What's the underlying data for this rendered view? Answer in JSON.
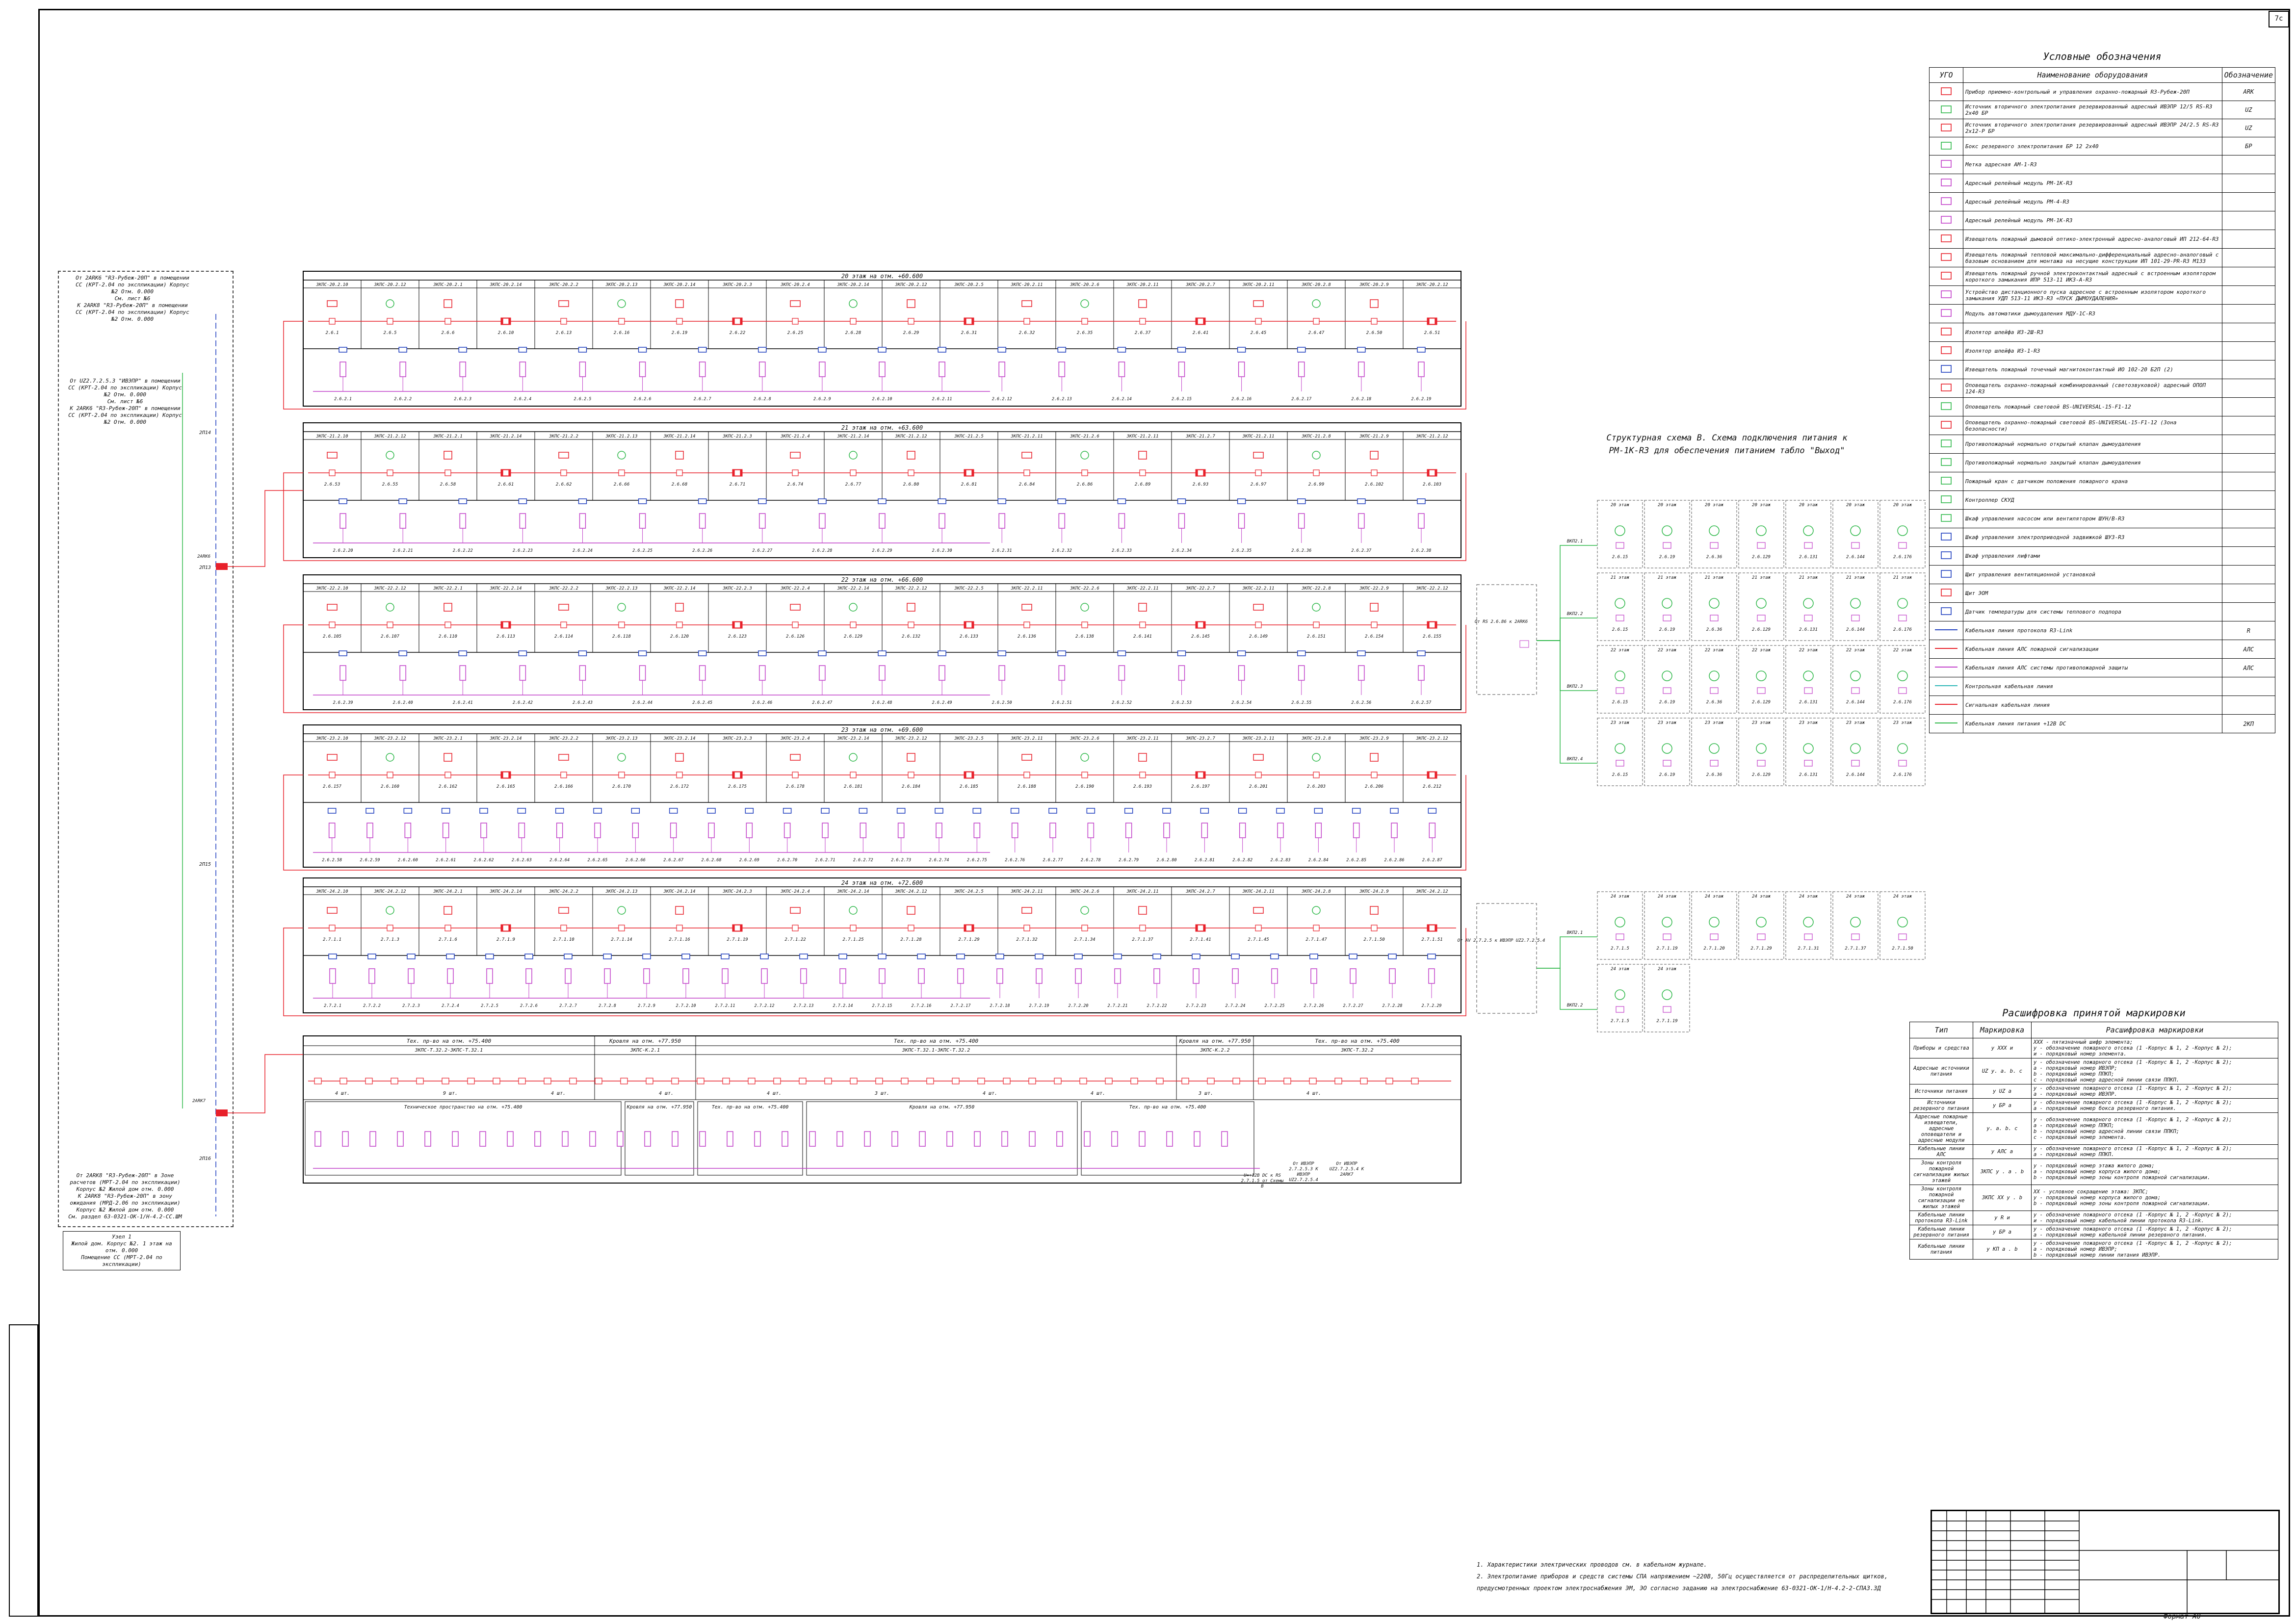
{
  "sheet": {
    "tag": "7с",
    "format": "Формат А0"
  },
  "left_notes": {
    "top": "От 2АRК6 \"R3-Рубеж-20П\" в помещении СС (КРТ-2.04 по экспликации) Корпус №2 Отм. 0.000\nСм. лист №6\nК 2АRК8 \"R3-Рубеж-20П\" в помещении СС (КРТ-2.04 по экспликации) Корпус №2 Отм. 0.000",
    "middle": "От UZ2.7.2.5.3 \"ИВЭПР\" в помещении СС (КРТ-2.04 по экспликации) Корпус №2 Отм. 0.000\nСм. лист №6\nК 2АRК6 \"R3-Рубеж-20П\" в помещении СС (КРТ-2.04 по экспликации) Корпус №2 Отм. 0.000",
    "bottom": "От 2АRК8 \"R3-Рубеж-20П\" в Зоне расчетов (МРТ-2.04 по экспликации) Корпус №2 Жилой дом отм. 0.000\nК 2АRК8 \"R3-Рубеж-20П\" в зону ожидания (МРД-2.06 по экспликации) Корпус №2 Жилой дом отм. 0.000\nСм. раздел 63-0321-ОК-1/Н-4.2-СС.ШМ",
    "unit": "Узел 1\nЖилой дом. Корпус №2. 1 этаж на отм. 0.000\nПомещение СС (МРТ-2.04 по экспликации)",
    "arkk_top": "2АRК6",
    "arkk_bottom": "2АRК7",
    "line_labels": [
      "2П14",
      "2П15",
      "2П16",
      "2П13"
    ]
  },
  "floors": [
    {
      "title": "20 этаж на отм. +60.600",
      "zones": [
        "ЗКПС-20.2.10",
        "ЗКПС-20.2.12",
        "ЗКПС-20.2.1",
        "ЗКПС-20.2.14",
        "ЗКПС-20.2.2",
        "ЗКПС-20.2.13",
        "ЗКПС-20.2.14",
        "ЗКПС-20.2.3",
        "ЗКПС-20.2.4",
        "ЗКПС-20.2.14",
        "ЗКПС-20.2.12",
        "ЗКПС-20.2.5",
        "ЗКПС-20.2.11",
        "ЗКПС-20.2.6",
        "ЗКПС-20.2.11",
        "ЗКПС-20.2.7",
        "ЗКПС-20.2.11",
        "ЗКПС-20.2.8",
        "ЗКПС-20.2.9",
        "ЗКПС-20.2.12"
      ],
      "devices": [
        "2.6.1",
        "2.6.5",
        "2.6.6",
        "2.6.10",
        "2.6.13",
        "2.6.16",
        "2.6.19",
        "2.6.22",
        "2.6.25",
        "2.6.28",
        "2.6.29",
        "2.6.31",
        "2.6.32",
        "2.6.35",
        "2.6.37",
        "2.6.41",
        "2.6.45",
        "2.6.47",
        "2.6.50",
        "2.6.51"
      ],
      "bottom": [
        "2.6.2.1",
        "2.6.2.2",
        "2.6.2.3",
        "2.6.2.4",
        "2.6.2.5",
        "2.6.2.6",
        "2.6.2.7",
        "2.6.2.8",
        "2.6.2.9",
        "2.6.2.10",
        "2.6.2.11",
        "2.6.2.12",
        "2.6.2.13",
        "2.6.2.14",
        "2.6.2.15",
        "2.6.2.16",
        "2.6.2.17",
        "2.6.2.18",
        "2.6.2.19"
      ]
    },
    {
      "title": "21 этаж на отм. +63.600",
      "zones": [
        "ЗКПС-21.2.10",
        "ЗКПС-21.2.12",
        "ЗКПС-21.2.1",
        "ЗКПС-21.2.14",
        "ЗКПС-21.2.2",
        "ЗКПС-21.2.13",
        "ЗКПС-21.2.14",
        "ЗКПС-21.2.3",
        "ЗКПС-21.2.4",
        "ЗКПС-21.2.14",
        "ЗКПС-21.2.12",
        "ЗКПС-21.2.5",
        "ЗКПС-21.2.11",
        "ЗКПС-21.2.6",
        "ЗКПС-21.2.11",
        "ЗКПС-21.2.7",
        "ЗКПС-21.2.11",
        "ЗКПС-21.2.8",
        "ЗКПС-21.2.9",
        "ЗКПС-21.2.12"
      ],
      "devices": [
        "2.6.53",
        "2.6.55",
        "2.6.58",
        "2.6.61",
        "2.6.62",
        "2.6.66",
        "2.6.68",
        "2.6.71",
        "2.6.74",
        "2.6.77",
        "2.6.80",
        "2.6.81",
        "2.6.84",
        "2.6.86",
        "2.6.89",
        "2.6.93",
        "2.6.97",
        "2.6.99",
        "2.6.102",
        "2.6.103"
      ],
      "bottom": [
        "2.6.2.20",
        "2.6.2.21",
        "2.6.2.22",
        "2.6.2.23",
        "2.6.2.24",
        "2.6.2.25",
        "2.6.2.26",
        "2.6.2.27",
        "2.6.2.28",
        "2.6.2.29",
        "2.6.2.30",
        "2.6.2.31",
        "2.6.2.32",
        "2.6.2.33",
        "2.6.2.34",
        "2.6.2.35",
        "2.6.2.36",
        "2.6.2.37",
        "2.6.2.38"
      ]
    },
    {
      "title": "22 этаж на отм. +66.600",
      "zones": [
        "ЗКПС-22.2.10",
        "ЗКПС-22.2.12",
        "ЗКПС-22.2.1",
        "ЗКПС-22.2.14",
        "ЗКПС-22.2.2",
        "ЗКПС-22.2.13",
        "ЗКПС-22.2.14",
        "ЗКПС-22.2.3",
        "ЗКПС-22.2.4",
        "ЗКПС-22.2.14",
        "ЗКПС-22.2.12",
        "ЗКПС-22.2.5",
        "ЗКПС-22.2.11",
        "ЗКПС-22.2.6",
        "ЗКПС-22.2.11",
        "ЗКПС-22.2.7",
        "ЗКПС-22.2.11",
        "ЗКПС-22.2.8",
        "ЗКПС-22.2.9",
        "ЗКПС-22.2.12"
      ],
      "devices": [
        "2.6.105",
        "2.6.107",
        "2.6.110",
        "2.6.113",
        "2.6.114",
        "2.6.118",
        "2.6.120",
        "2.6.123",
        "2.6.126",
        "2.6.129",
        "2.6.132",
        "2.6.133",
        "2.6.136",
        "2.6.138",
        "2.6.141",
        "2.6.145",
        "2.6.149",
        "2.6.151",
        "2.6.154",
        "2.6.155"
      ],
      "bottom": [
        "2.6.2.39",
        "2.6.2.40",
        "2.6.2.41",
        "2.6.2.42",
        "2.6.2.43",
        "2.6.2.44",
        "2.6.2.45",
        "2.6.2.46",
        "2.6.2.47",
        "2.6.2.48",
        "2.6.2.49",
        "2.6.2.50",
        "2.6.2.51",
        "2.6.2.52",
        "2.6.2.53",
        "2.6.2.54",
        "2.6.2.55",
        "2.6.2.56",
        "2.6.2.57"
      ]
    },
    {
      "title": "23 этаж на отм. +69.600",
      "zones": [
        "ЗКПС-23.2.10",
        "ЗКПС-23.2.12",
        "ЗКПС-23.2.1",
        "ЗКПС-23.2.14",
        "ЗКПС-23.2.2",
        "ЗКПС-23.2.13",
        "ЗКПС-23.2.14",
        "ЗКПС-23.2.3",
        "ЗКПС-23.2.4",
        "ЗКПС-23.2.14",
        "ЗКПС-23.2.12",
        "ЗКПС-23.2.5",
        "ЗКПС-23.2.11",
        "ЗКПС-23.2.6",
        "ЗКПС-23.2.11",
        "ЗКПС-23.2.7",
        "ЗКПС-23.2.11",
        "ЗКПС-23.2.8",
        "ЗКПС-23.2.9",
        "ЗКПС-23.2.12"
      ],
      "devices": [
        "2.6.157",
        "2.6.160",
        "2.6.162",
        "2.6.165",
        "2.6.166",
        "2.6.170",
        "2.6.172",
        "2.6.175",
        "2.6.178",
        "2.6.181",
        "2.6.184",
        "2.6.185",
        "2.6.188",
        "2.6.190",
        "2.6.193",
        "2.6.197",
        "2.6.201",
        "2.6.203",
        "2.6.206",
        "2.6.212"
      ],
      "bottom": [
        "2.6.2.58",
        "2.6.2.59",
        "2.6.2.60",
        "2.6.2.61",
        "2.6.2.62",
        "2.6.2.63",
        "2.6.2.64",
        "2.6.2.65",
        "2.6.2.66",
        "2.6.2.67",
        "2.6.2.68",
        "2.6.2.69",
        "2.6.2.70",
        "2.6.2.71",
        "2.6.2.72",
        "2.6.2.73",
        "2.6.2.74",
        "2.6.2.75",
        "2.6.2.76",
        "2.6.2.77",
        "2.6.2.78",
        "2.6.2.79",
        "2.6.2.80",
        "2.6.2.81",
        "2.6.2.82",
        "2.6.2.83",
        "2.6.2.84",
        "2.6.2.85",
        "2.6.2.86",
        "2.6.2.87"
      ]
    },
    {
      "title": "24 этаж на отм. +72.600",
      "zones": [
        "ЗКПС-24.2.10",
        "ЗКПС-24.2.12",
        "ЗКПС-24.2.1",
        "ЗКПС-24.2.14",
        "ЗКПС-24.2.2",
        "ЗКПС-24.2.13",
        "ЗКПС-24.2.14",
        "ЗКПС-24.2.3",
        "ЗКПС-24.2.4",
        "ЗКПС-24.2.14",
        "ЗКПС-24.2.12",
        "ЗКПС-24.2.5",
        "ЗКПС-24.2.11",
        "ЗКПС-24.2.6",
        "ЗКПС-24.2.11",
        "ЗКПС-24.2.7",
        "ЗКПС-24.2.11",
        "ЗКПС-24.2.8",
        "ЗКПС-24.2.9",
        "ЗКПС-24.2.12"
      ],
      "devices": [
        "2.7.1.1",
        "2.7.1.3",
        "2.7.1.6",
        "2.7.1.9",
        "2.7.1.10",
        "2.7.1.14",
        "2.7.1.16",
        "2.7.1.19",
        "2.7.1.22",
        "2.7.1.25",
        "2.7.1.28",
        "2.7.1.29",
        "2.7.1.32",
        "2.7.1.34",
        "2.7.1.37",
        "2.7.1.41",
        "2.7.1.45",
        "2.7.1.47",
        "2.7.1.50",
        "2.7.1.51"
      ],
      "bottom": [
        "2.7.2.1",
        "2.7.2.2",
        "2.7.2.3",
        "2.7.2.4",
        "2.7.2.5",
        "2.7.2.6",
        "2.7.2.7",
        "2.7.2.8",
        "2.7.2.9",
        "2.7.2.10",
        "2.7.2.11",
        "2.7.2.12",
        "2.7.2.13",
        "2.7.2.14",
        "2.7.2.15",
        "2.7.2.16",
        "2.7.2.17",
        "2.7.2.18",
        "2.7.2.19",
        "2.7.2.20",
        "2.7.2.21",
        "2.7.2.22",
        "2.7.2.23",
        "2.7.2.24",
        "2.7.2.25",
        "2.7.2.26",
        "2.7.2.27",
        "2.7.2.28",
        "2.7.2.29"
      ]
    }
  ],
  "tech_floor": {
    "sections": [
      "Тех. пр-во на отм. +75.400",
      "Кровля на отм. +77.950",
      "Тех. пр-во на отм. +75.400",
      "Кровля на отм. +77.950",
      "Тех. пр-во на отм. +75.400"
    ],
    "zones": [
      "ЗКПС-Т.32.2-ЗКПС-Т.32.1",
      "ЗКПС-К.2.1",
      "ЗКПС-Т.32.1-ЗКПС-Т.32.2",
      "ЗКПС-К.2.2",
      "ЗКПС-Т.32.2"
    ],
    "lower_sections": [
      "Техническое пространство на отм. +75.400",
      "Кровля на отм. +77.950",
      "Тех. пр-во на отм. +75.400",
      "Кровля на отм. +77.950",
      "Тех. пр-во на отм. +75.400"
    ],
    "counts": [
      "4 шт.",
      "9 шт.",
      "4 шт.",
      "4 шт.",
      "4 шт.",
      "3 шт.",
      "4 шт.",
      "4 шт.",
      "3 шт.",
      "4 шт."
    ],
    "note_right": "От ИВЭПР 2.7.2.5.3 К ИВЭПР UZ2.7.2.5.4",
    "note_left": "U=+12В DC к RS 2.7.1.5 от Схемы В",
    "note_arkk": "От ИВЭПР UZ2.7.2.5.4 К 2АRК7"
  },
  "structure": {
    "title": "Структурная схема В. Схема подключения питания к РМ-1К-R3 для обеспечения питанием табло \"Выход\"",
    "top_floors": [
      "20 этаж",
      "21 этаж",
      "22 этаж",
      "23 этаж"
    ],
    "top_devices": [
      "2.6.15",
      "2.6.19",
      "2.6.36",
      "2.6.129",
      "2.6.131",
      "2.6.144",
      "2.6.176"
    ],
    "bottom_floors": [
      "24 этаж"
    ],
    "bottom_devices": [
      "2.7.1.5",
      "2.7.1.19",
      "2.7.1.20",
      "2.7.1.29",
      "2.7.1.31",
      "2.7.1.37",
      "2.7.1.50"
    ],
    "source_top": "От RS 2.6.86 к 2АRК6",
    "source_bottom": "От АV 2.7.2.5 к ИВЭПР UZ2.7.2.5.4",
    "cable_labels_top": [
      "ВКП2.1",
      "ВКП2.2",
      "ВКП2.3",
      "ВКП2.4"
    ],
    "cable_labels_bottom": [
      "ВКП2.1",
      "ВКП2.2"
    ]
  },
  "legend": {
    "title": "Условные обозначения",
    "headers": [
      "УГО",
      "Наименование оборудования",
      "Обозначение"
    ],
    "rows": [
      {
        "name": "Прибор приемно-контрольный и управления охранно-пожарный R3-Рубеж-20П",
        "code": "АRК",
        "color": "#e8202a"
      },
      {
        "name": "Источник вторичного электропитания резервированный адресный ИВЭПР 12/5 RS-R3 2х40 БР",
        "code": "UZ",
        "color": "#2fb84a"
      },
      {
        "name": "Источник вторичного электропитания резервированный адресный ИВЭПР 24/2.5 RS-R3 2х12-Р БР",
        "code": "UZ",
        "color": "#e8202a"
      },
      {
        "name": "Бокс резервного электропитания БР 12 2х40",
        "code": "БР",
        "color": "#2fb84a"
      },
      {
        "name": "Метка адресная АМ-1-R3",
        "code": "",
        "color": "#c13fc9"
      },
      {
        "name": "Адресный релейный модуль РМ-1К-R3",
        "code": "",
        "color": "#c13fc9"
      },
      {
        "name": "Адресный релейный модуль РМ-4-R3",
        "code": "",
        "color": "#c13fc9"
      },
      {
        "name": "Адресный релейный модуль РМ-1К-R3",
        "code": "",
        "color": "#c13fc9"
      },
      {
        "name": "Извещатель пожарный дымовой оптико-электронный адресно-аналоговый ИП 212-64-R3",
        "code": "",
        "color": "#e8202a"
      },
      {
        "name": "Извещатель пожарный тепловой максимально-дифференциальный адресно-аналоговый с базовым основанием для монтажа на несущие конструкции ИП 101-29-PR-R3 М133",
        "code": "",
        "color": "#e8202a"
      },
      {
        "name": "Извещатель пожарный ручной электроконтактный адресный с встроенным изолятором короткого замыкания ИПР 513-11 ИКЗ-А-R3",
        "code": "",
        "color": "#e8202a"
      },
      {
        "name": "Устройство дистанционного пуска адресное с встроенным изолятором короткого замыкания УДП 513-11 ИКЗ-R3 «ПУСК ДЫМОУДАЛЕНИЯ»",
        "code": "",
        "color": "#c13fc9"
      },
      {
        "name": "Модуль автоматики дымоудаления МДУ-1С-R3",
        "code": "",
        "color": "#c13fc9"
      },
      {
        "name": "Изолятор шлейфа ИЗ-2Ш-R3",
        "code": "",
        "color": "#e8202a"
      },
      {
        "name": "Изолятор шлейфа ИЗ-1-R3",
        "code": "",
        "color": "#e8202a"
      },
      {
        "name": "Извещатель пожарный точечный магнитоконтактный ИО 102-20 Б2П (2)",
        "code": "",
        "color": "#1f3fbf"
      },
      {
        "name": "Оповещатель охранно-пожарный комбинированный (светозвуковой) адресный ОПОП 124-R3",
        "code": "",
        "color": "#e8202a"
      },
      {
        "name": "Оповещатель пожарный световой BS-UNIVERSAL-15-F1-12",
        "code": "",
        "color": "#2fb84a"
      },
      {
        "name": "Оповещатель охранно-пожарный световой BS-UNIVERSAL-15-F1-12 (Зона безопасности)",
        "code": "",
        "color": "#e8202a"
      },
      {
        "name": "Противопожарный нормально открытый клапан дымоудаления",
        "code": "",
        "color": "#2fb84a"
      },
      {
        "name": "Противопожарный нормально закрытый клапан дымоудаления",
        "code": "",
        "color": "#2fb84a"
      },
      {
        "name": "Пожарный кран с датчиком положения пожарного крана",
        "code": "",
        "color": "#2fb84a"
      },
      {
        "name": "Контроллер СКУД",
        "code": "",
        "color": "#2fb84a"
      },
      {
        "name": "Шкаф управления насосом или вентилятором ШУН/В-R3",
        "code": "",
        "color": "#2fb84a"
      },
      {
        "name": "Шкаф управления электроприводной задвижкой ШУЗ-R3",
        "code": "",
        "color": "#1f3fbf"
      },
      {
        "name": "Шкаф управления лифтами",
        "code": "",
        "color": "#1f3fbf"
      },
      {
        "name": "Щит управления вентиляционной установкой",
        "code": "",
        "color": "#1f3fbf"
      },
      {
        "name": "Щит ЭОМ",
        "code": "",
        "color": "#e8202a"
      },
      {
        "name": "Датчик температуры для системы теплового подпора",
        "code": "",
        "color": "#1f3fbf"
      },
      {
        "name": "Кабельная линия протокола R3-Link",
        "code": "R",
        "color": "#1f3fbf"
      },
      {
        "name": "Кабельная линия АЛС пожарной сигнализации",
        "code": "АЛС",
        "color": "#e8202a"
      },
      {
        "name": "Кабельная линия АЛС системы противопожарной защиты",
        "code": "АЛС",
        "color": "#c13fc9"
      },
      {
        "name": "Контрольная кабельная линия",
        "code": "",
        "color": "#2fb8b8"
      },
      {
        "name": "Сигнальная кабельная линия",
        "code": "",
        "color": "#e8202a"
      },
      {
        "name": "Кабельная линия питания +12В DC",
        "code": "2КП",
        "color": "#2fb84a"
      }
    ]
  },
  "decode": {
    "title": "Расшифровка принятой маркировки",
    "headers": [
      "Тип",
      "Маркировка",
      "Расшифровка маркировки"
    ],
    "rows": [
      {
        "type": "Приборы и средства",
        "mark": "у ХХХ и",
        "text": "ХХХ - пятизначный шифр элемента;\nу - обозначение пожарного отсека (1 -Корпус № 1, 2 -Корпус № 2);\nи - порядковый номер элемента."
      },
      {
        "type": "Адресные источники питания",
        "mark": "UZ у. а. b. c",
        "text": "у - обозначение пожарного отсека (1 -Корпус № 1, 2 -Корпус № 2);\nа - порядковый номер ИВЭПР;\nb - порядковый номер ППКП;\nc - порядковый номер адресной линии связи ППКП."
      },
      {
        "type": "Источники питания",
        "mark": "у UZ а",
        "text": "у - обозначение пожарного отсека (1 -Корпус № 1, 2 -Корпус № 2);\nа - порядковый номер ИВЭПР."
      },
      {
        "type": "Источники резервного питания",
        "mark": "у БР а",
        "text": "у - обозначение пожарного отсека (1 -Корпус № 1, 2 -Корпус № 2);\nа - порядковый номер бокса резервного питания."
      },
      {
        "type": "Адресные пожарные извещатели, адресные оповещатели и адресные модули",
        "mark": "у. а. b. c",
        "text": "у - обозначение пожарного отсека (1 -Корпус № 1, 2 -Корпус № 2);\nа - порядковый номер ППКП;\nb - порядковый номер адресной линии связи ППКП;\nc - порядковый номер элемента."
      },
      {
        "type": "Кабельные линии АЛС",
        "mark": "у АЛС а",
        "text": "у - обозначение пожарного отсека (1 -Корпус № 1, 2 -Корпус № 2);\nа - порядковый номер ППКП."
      },
      {
        "type": "Зоны контроля пожарной сигнализации жилых этажей",
        "mark": "ЗКПС у . а . b",
        "text": "у - порядковый номер этажа жилого дома;\nа - порядковый номер корпуса жилого дома;\nb - порядковый номер зоны контроля пожарной сигнализации."
      },
      {
        "type": "Зоны контроля пожарной сигнализации не жилых этажей",
        "mark": "ЗКПС ХХ у . b",
        "text": "ХХ - условное сокращение этажа: ЗКПС;\nу - порядковый номер корпуса жилого дома;\nb - порядковый номер зоны контроля пожарной сигнализации."
      },
      {
        "type": "Кабельные линии протокола R3-Link",
        "mark": "у R и",
        "text": "у - обозначение пожарного отсека (1 -Корпус № 1, 2 -Корпус № 2);\nи - порядковый номер кабельной линии протокола R3-Link."
      },
      {
        "type": "Кабельные линии резервного питания",
        "mark": "у БР а",
        "text": "у - обозначение пожарного отсека (1 -Корпус № 1, 2 -Корпус № 2);\nа - порядковый номер кабельной линии резервного питания."
      },
      {
        "type": "Кабельные линии питания",
        "mark": "у КП а . b",
        "text": "у - обозначение пожарного отсека (1 -Корпус № 1, 2 -Корпус № 2);\nа - порядковый номер ИВЭПР;\nb - порядковый номер линии питания ИВЭПР."
      }
    ]
  },
  "notes": [
    "1.  Характеристики электрических проводов см. в кабельном журнале.",
    "2.  Электропитание приборов и средств системы СПА напряжением ~220В, 50Гц осуществляется от распределительных щитков, предусмотренных проектом электроснабжения ЭМ, ЭО согласно заданию на электроснабжение 63-0321-ОК-1/Н-4.2-2-СПА3.ЗД"
  ],
  "colors": {
    "red": "#e8202a",
    "green": "#2fb84a",
    "magenta": "#c13fc9",
    "blue": "#1f3fbf",
    "cyan": "#2fb8b8"
  }
}
